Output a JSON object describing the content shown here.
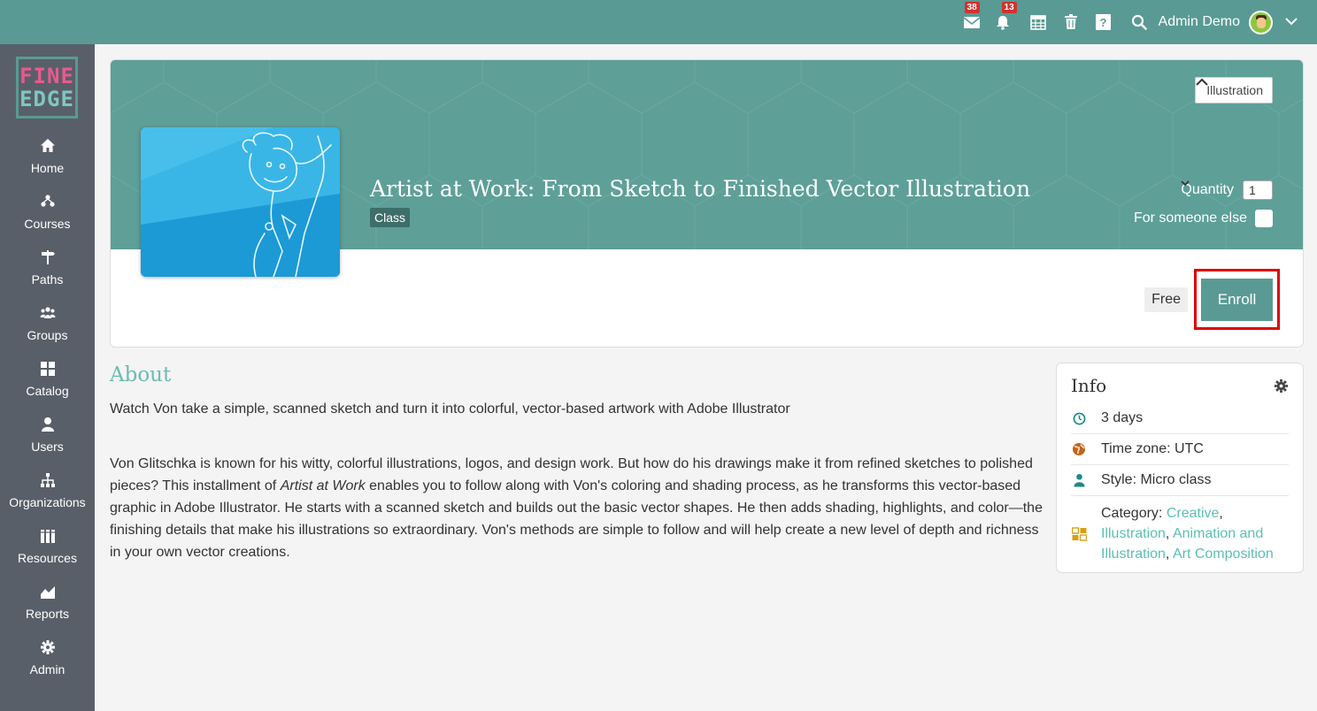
{
  "topbar": {
    "mail_badge": "38",
    "notifications_badge": "13",
    "user_name": "Admin Demo",
    "icons": [
      "mail-icon",
      "bell-icon",
      "calendar-icon",
      "trash-icon",
      "help-icon",
      "search-icon",
      "avatar",
      "chevron-down-icon"
    ]
  },
  "logo": {
    "line1": "FINE",
    "line2": "EDGE"
  },
  "sidebar": {
    "items": [
      {
        "label": "Home",
        "icon": "home-icon"
      },
      {
        "label": "Courses",
        "icon": "courses-icon"
      },
      {
        "label": "Paths",
        "icon": "signpost-icon"
      },
      {
        "label": "Groups",
        "icon": "groups-icon"
      },
      {
        "label": "Catalog",
        "icon": "grid-icon"
      },
      {
        "label": "Users",
        "icon": "user-icon"
      },
      {
        "label": "Organizations",
        "icon": "org-chart-icon"
      },
      {
        "label": "Resources",
        "icon": "books-icon"
      },
      {
        "label": "Reports",
        "icon": "chart-icon"
      },
      {
        "label": "Admin",
        "icon": "gear-icon"
      }
    ]
  },
  "course": {
    "title": "Artist at Work: From Sketch to Finished Vector Illustration",
    "type_badge": "Class",
    "category_button": "Illustration",
    "quantity_label": "Quantity",
    "quantity_value": "1",
    "for_someone_else_label": "For someone else",
    "price": "Free",
    "enroll_label": "Enroll"
  },
  "about": {
    "title": "About",
    "lead": "Watch Von take a simple, scanned sketch and turn it into colorful, vector-based artwork with Adobe Illustrator",
    "body_before_italic": "Von Glitschka is known for his witty, colorful illustrations, logos, and design work. But how do his drawings make it from refined sketches to polished pieces? This installment of ",
    "body_italic": "Artist at Work",
    "body_after_italic": " enables you to follow along with Von's coloring and shading process, as he transforms this vector-based graphic in Adobe Illustrator. He starts with a scanned sketch and builds out the basic vector shapes. He then adds shading, highlights, and color—the finishing details that make his illustrations so extraordinary. Von's methods are simple to follow and will help create a new level of depth and richness in your own vector creations."
  },
  "info": {
    "title": "Info",
    "duration": "3 days",
    "timezone": "Time zone: UTC",
    "style": "Style: Micro class",
    "category_label": "Category: ",
    "categories": [
      "Creative",
      "Illustration",
      "Animation and Illustration",
      "Art Composition"
    ],
    "colors": {
      "clock": "#1a8a86",
      "globe": "#c0641c",
      "person": "#1a8a86",
      "category": "#d4a017"
    }
  },
  "colors": {
    "brand": "#599a94",
    "sidebar": "#595f69",
    "link": "#5bbfb5",
    "highlight": "#e00000"
  }
}
